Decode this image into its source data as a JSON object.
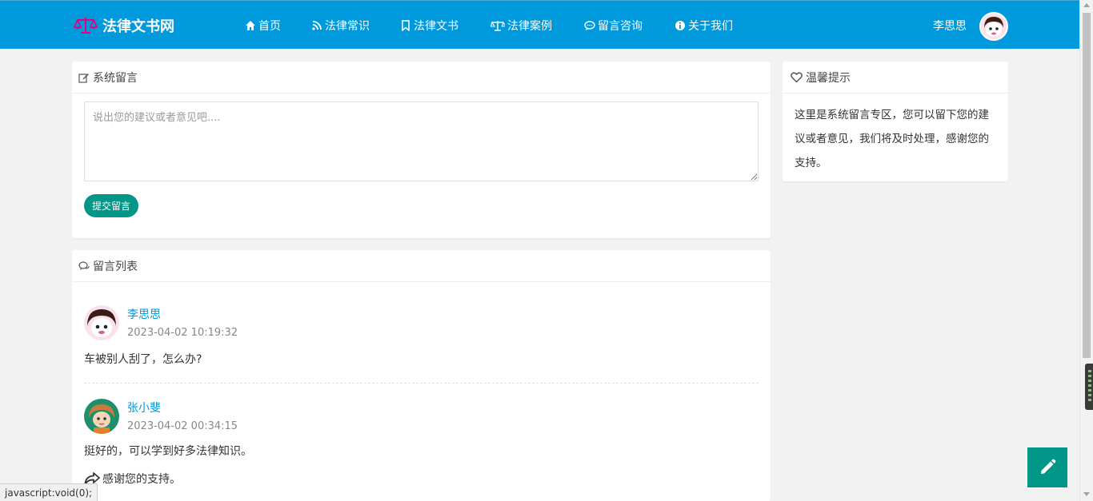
{
  "header": {
    "site_name": "法律文书网",
    "nav": [
      {
        "label": "首页",
        "icon": "home-icon"
      },
      {
        "label": "法律常识",
        "icon": "rss-icon"
      },
      {
        "label": "法律文书",
        "icon": "bookmark-icon"
      },
      {
        "label": "法律案例",
        "icon": "scale-icon"
      },
      {
        "label": "留言咨询",
        "icon": "comment-icon"
      },
      {
        "label": "关于我们",
        "icon": "info-icon"
      }
    ],
    "user_name": "李思思"
  },
  "message_form": {
    "title": "系统留言",
    "placeholder": "说出您的建议或者意见吧....",
    "value": "",
    "submit_label": "提交留言"
  },
  "message_list": {
    "title": "留言列表",
    "items": [
      {
        "name": "李思思",
        "time": "2023-04-02 10:19:32",
        "content": "车被别人刮了，怎么办?"
      },
      {
        "name": "张小斐",
        "time": "2023-04-02 00:34:15",
        "content": "挺好的，可以学到好多法律知识。",
        "reply": "感谢您的支持。"
      }
    ]
  },
  "tip": {
    "title": "温馨提示",
    "text": "这里是系统留言专区，您可以留下您的建议或者意见，我们将及时处理，感谢您的支持。"
  },
  "status_bar": "javascript:void(0);",
  "colors": {
    "header_bg": "#0099dc",
    "accent": "#009688",
    "link": "#0099dc"
  }
}
